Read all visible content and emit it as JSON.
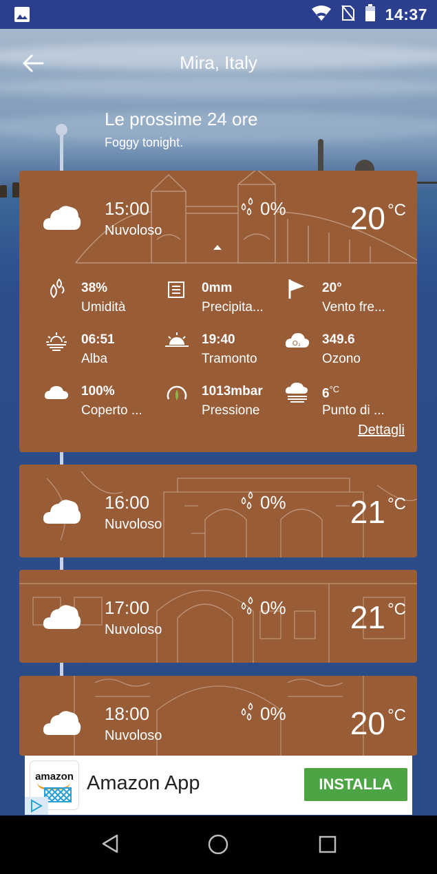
{
  "status_bar": {
    "time": "14:37",
    "icons": [
      "image-icon",
      "wifi-icon",
      "no-sim-icon",
      "battery-icon"
    ]
  },
  "header": {
    "title": "Mira, Italy",
    "back_icon": "arrow-left-icon"
  },
  "section": {
    "title": "Le prossime 24 ore",
    "subtitle": "Foggy tonight."
  },
  "colors": {
    "status_bar": "#2c3f8f",
    "card": "#985c37",
    "timeline": "#c9d2e3",
    "install_button": "#4ca445",
    "navbar": "#000000"
  },
  "expanded_card": {
    "time": "15:00",
    "condition": "Nuvoloso",
    "rain_chance": "0%",
    "temperature": "20",
    "unit": "°C",
    "details": [
      {
        "icon": "humidity-icon",
        "value": "38%",
        "label": "Umidità"
      },
      {
        "icon": "precipitation-gauge-icon",
        "value": "0mm",
        "label": "Precipita..."
      },
      {
        "icon": "wind-flag-icon",
        "value": "20°",
        "label": "Vento fre..."
      },
      {
        "icon": "sunrise-icon",
        "value": "06:51",
        "label": "Alba"
      },
      {
        "icon": "sunset-icon",
        "value": "19:40",
        "label": "Tramonto"
      },
      {
        "icon": "ozone-icon",
        "value": "349.6",
        "label": "Ozono"
      },
      {
        "icon": "cloud-icon",
        "value": "100%",
        "label": "Coperto ..."
      },
      {
        "icon": "pressure-icon",
        "value": "1013mbar",
        "label": "Pressione"
      },
      {
        "icon": "dew-point-icon",
        "value": "6",
        "value_unit": "°C",
        "label": "Punto di ..."
      }
    ],
    "details_link": "Dettagli"
  },
  "hourly": [
    {
      "time": "16:00",
      "condition": "Nuvoloso",
      "rain_chance": "0%",
      "temperature": "21",
      "unit": "°C"
    },
    {
      "time": "17:00",
      "condition": "Nuvoloso",
      "rain_chance": "0%",
      "temperature": "21",
      "unit": "°C"
    },
    {
      "time": "18:00",
      "condition": "Nuvoloso",
      "rain_chance": "0%",
      "temperature": "20",
      "unit": "°C"
    }
  ],
  "ad": {
    "logo_text": "amazon",
    "title": "Amazon App",
    "button": "INSTALLA"
  },
  "navbar": {
    "icons": [
      "back-triangle-icon",
      "home-circle-icon",
      "recents-square-icon"
    ]
  }
}
